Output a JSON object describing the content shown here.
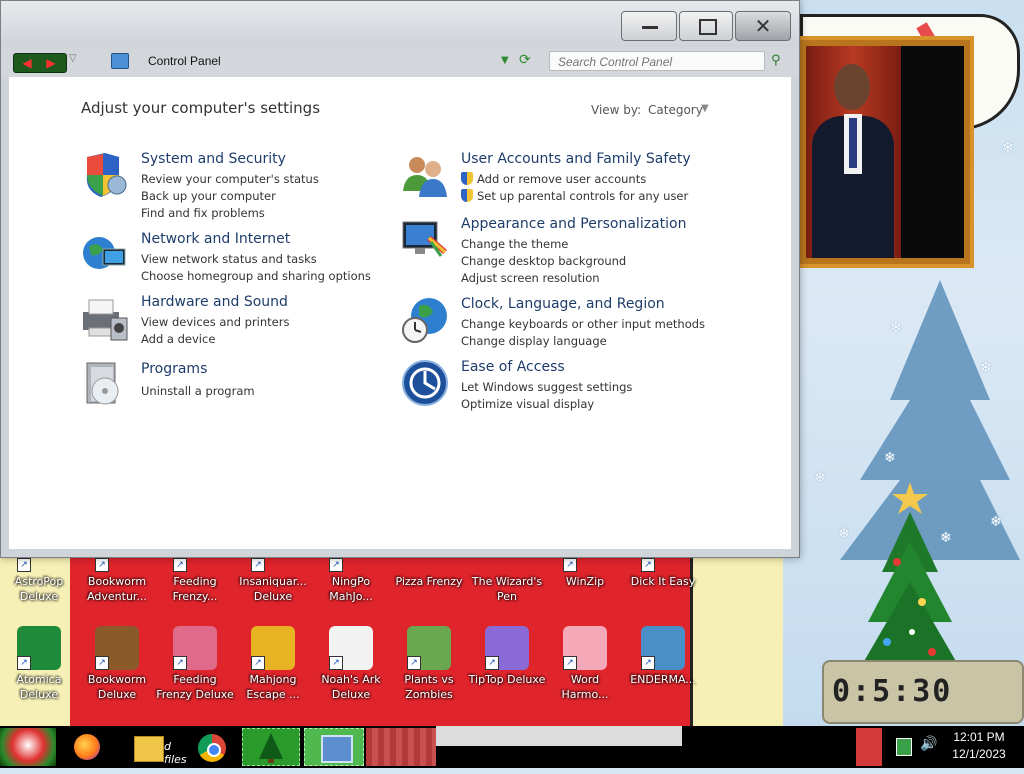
{
  "window": {
    "controls": {
      "minimize": "minimize",
      "maximize": "maximize",
      "close": "✕"
    },
    "address": "Control Panel",
    "search_placeholder": "Search Control Panel"
  },
  "content": {
    "title": "Adjust your computer's settings",
    "view_by_label": "View by:",
    "view_by_value": "Category",
    "categories_left": [
      {
        "title": "System and Security",
        "icon": "shield-icon",
        "links": [
          "Review your computer's status",
          "Back up your computer",
          "Find and fix problems"
        ]
      },
      {
        "title": "Network and Internet",
        "icon": "network-globe-icon",
        "links": [
          "View network status and tasks",
          "Choose homegroup and sharing options"
        ]
      },
      {
        "title": "Hardware and Sound",
        "icon": "printer-icon",
        "links": [
          "View devices and printers",
          "Add a device"
        ]
      },
      {
        "title": "Programs",
        "icon": "programs-disc-icon",
        "links": [
          "Uninstall a program"
        ]
      }
    ],
    "categories_right": [
      {
        "title": "User Accounts and Family Safety",
        "icon": "users-icon",
        "links": [
          "Add or remove user accounts",
          "Set up parental controls for any user"
        ]
      },
      {
        "title": "Appearance and Personalization",
        "icon": "monitor-paint-icon",
        "links": [
          "Change the theme",
          "Change desktop background",
          "Adjust screen resolution"
        ]
      },
      {
        "title": "Clock, Language, and Region",
        "icon": "clock-globe-icon",
        "links": [
          "Change keyboards or other input methods",
          "Change display language"
        ]
      },
      {
        "title": "Ease of Access",
        "icon": "ease-of-access-icon",
        "links": [
          "Let Windows suggest settings",
          "Optimize visual display"
        ]
      }
    ]
  },
  "desktop_icons": {
    "top_row": [
      {
        "label": "AstroPop Deluxe"
      },
      {
        "label": "Bookworm Adventur..."
      },
      {
        "label": "Feeding Frenzy..."
      },
      {
        "label": "Insaniquar... Deluxe"
      },
      {
        "label": "NingPo MahJo..."
      },
      {
        "label": "Pizza Frenzy"
      },
      {
        "label": "The Wizard's Pen"
      },
      {
        "label": "WinZip"
      },
      {
        "label": "Dick It Easy"
      }
    ],
    "bottom_row": [
      {
        "label": "Atomica Deluxe",
        "color": "#1f8a3a"
      },
      {
        "label": "Bookworm Deluxe",
        "color": "#8b5a2b"
      },
      {
        "label": "Feeding Frenzy Deluxe",
        "color": "#e06a8a"
      },
      {
        "label": "Mahjong Escape ...",
        "color": "#e8b323"
      },
      {
        "label": "Noah's Ark Deluxe",
        "color": "#f2f2f2"
      },
      {
        "label": "Plants vs Zombies",
        "color": "#6aa84f"
      },
      {
        "label": "TipTop Deluxe",
        "color": "#8a6ad6"
      },
      {
        "label": "Word Harmo...",
        "color": "#f4a8b8"
      },
      {
        "label": "ENDERMA...",
        "color": "#4a90c8"
      }
    ]
  },
  "widget": {
    "clock_digits": "0:5:30"
  },
  "taskbar": {
    "explorer_text": "d files",
    "time": "12:01 PM",
    "date": "12/1/2023"
  }
}
